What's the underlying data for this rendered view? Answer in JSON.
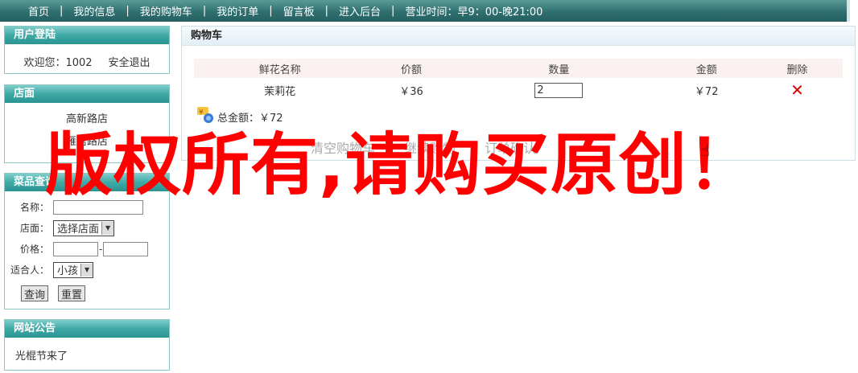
{
  "nav": {
    "items": [
      "首页",
      "我的信息",
      "我的购物车",
      "我的订单",
      "留言板",
      "进入后台"
    ],
    "separator": "|",
    "hours": "营业时间：早9：00-晚21:00"
  },
  "login_panel": {
    "title": "用户登陆",
    "welcome": "欢迎您：1002",
    "logout": "安全退出"
  },
  "store_panel": {
    "title": "店面",
    "stores": [
      "高新路店",
      "雁塔路店"
    ]
  },
  "search_panel": {
    "title": "菜品查询",
    "name_label": "名称：",
    "store_label": "店面：",
    "store_value": "选择店面",
    "price_label": "价格：",
    "price_sep": "-",
    "audience_label": "适合人：",
    "audience_value": "小孩",
    "search_button": "查询",
    "reset_button": "重置"
  },
  "notice_panel": {
    "title": "网站公告",
    "text": "光棍节来了"
  },
  "cart": {
    "title": "购物车",
    "columns": [
      "鲜花名称",
      "价额",
      "数量",
      "金额",
      "删除"
    ],
    "rows": [
      {
        "name": "茉莉花",
        "price": "￥36",
        "qty": "2",
        "amount": "￥72"
      }
    ],
    "total_label": "总金额：￥72",
    "links": [
      "清空购物车",
      "继续购物",
      "订单确认"
    ]
  },
  "watermark": "版权所有,请购买原创！",
  "colors": {
    "nav_bg": "#2f6f70",
    "panel_head": "#3fa9a6",
    "watermark": "#ff0000"
  }
}
